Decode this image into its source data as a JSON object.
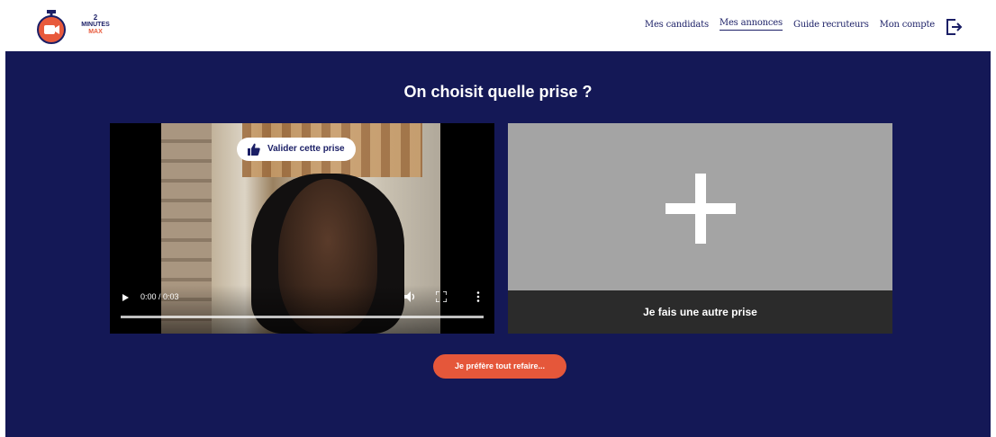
{
  "logo": {
    "line1": "2",
    "line2": "MINUTES",
    "line3": "MAX",
    "icon": "stopwatch-camera-icon",
    "accent": "#e85a3c"
  },
  "nav": {
    "items": [
      {
        "label": "Mes candidats"
      },
      {
        "label": "Mes annonces",
        "active": true
      },
      {
        "label": "Guide recruteurs"
      },
      {
        "label": "Mon compte"
      }
    ],
    "logout_icon": "logout-icon"
  },
  "colors": {
    "navy": "#141856",
    "text_navy": "#1b1f66",
    "orange": "#e5573a",
    "panel_gray": "#a4a4a4",
    "panel_dark": "#2b2b2b"
  },
  "page": {
    "title": "On choisit quelle prise ?"
  },
  "video": {
    "validate_label": "Valider cette prise",
    "validate_icon": "thumbs-up-icon",
    "time": "0:00 / 0:03",
    "controls": [
      "play-icon",
      "volume-icon",
      "fullscreen-icon",
      "more-vertical-icon"
    ]
  },
  "retake": {
    "label": "Je fais une autre prise",
    "icon": "plus-icon"
  },
  "redo": {
    "label": "Je préfère tout refaire..."
  }
}
